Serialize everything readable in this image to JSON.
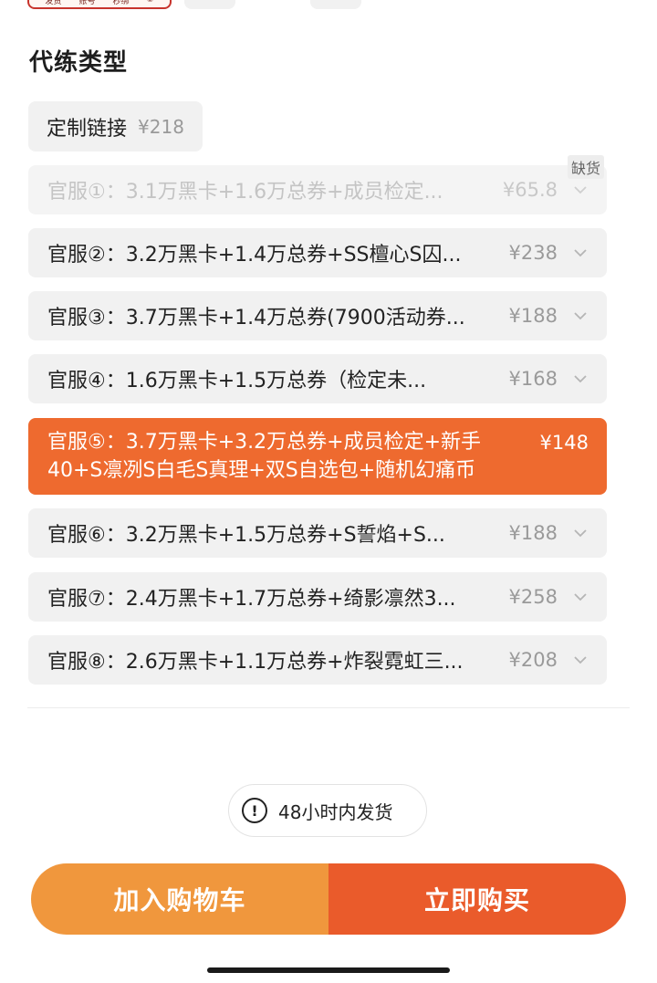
{
  "thumbnails": {
    "first_labels": [
      "发货",
      "账号",
      "秒绑",
      "⑤"
    ]
  },
  "section": {
    "title": "代练类型"
  },
  "custom": {
    "label": "定制链接",
    "price": "¥218"
  },
  "stock_tag": "缺货",
  "options": [
    {
      "label": "官服①：3.1万黑卡+1.6万总券+成员检定...",
      "price": "¥65.8",
      "state": "disabled"
    },
    {
      "label": "官服②：3.2万黑卡+1.4万总券+SS檀心S囚...",
      "price": "¥238",
      "state": "normal"
    },
    {
      "label": "官服③：3.7万黑卡+1.4万总券(7900活动券...",
      "price": "¥188",
      "state": "normal"
    },
    {
      "label": "官服④：1.6万黑卡+1.5万总券（检定未...",
      "price": "¥168",
      "state": "normal"
    },
    {
      "label": "官服⑤：3.7万黑卡+3.2万总券+成员检定+新手40+S凛冽S白毛S真理+双S自选包+随机幻痛币",
      "price": "¥148",
      "state": "selected"
    },
    {
      "label": "官服⑥：3.2万黑卡+1.5万总券+S誓焰+S...",
      "price": "¥188",
      "state": "normal"
    },
    {
      "label": "官服⑦：2.4万黑卡+1.7万总券+绮影凛然3...",
      "price": "¥258",
      "state": "normal"
    },
    {
      "label": "官服⑧：2.6万黑卡+1.1万总券+炸裂霓虹三...",
      "price": "¥208",
      "state": "normal"
    }
  ],
  "delivery": {
    "icon": "exclamation-circle-icon",
    "text": "48小时内发货"
  },
  "actions": {
    "cart_label": "加入购物车",
    "buy_label": "立即购买"
  },
  "colors": {
    "selected": "#ee6a2f",
    "cart": "#f0973d",
    "buy": "#ea5b2b"
  }
}
